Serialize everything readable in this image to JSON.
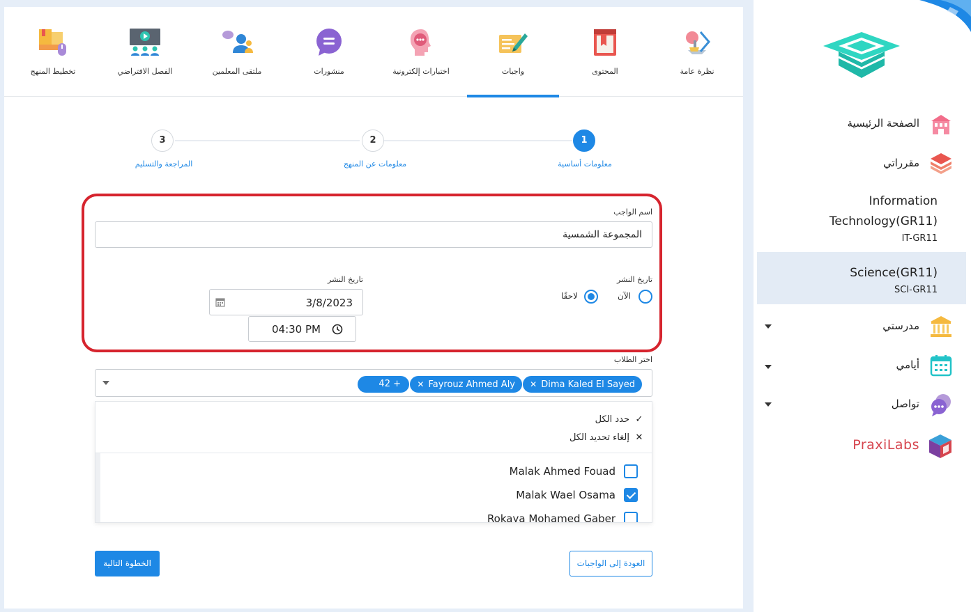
{
  "tabs": [
    {
      "label": "نظرة عامة",
      "icon": "overview-icon"
    },
    {
      "label": "المحتوى",
      "icon": "content-book-icon"
    },
    {
      "label": "واجبات",
      "icon": "assignments-icon",
      "active": true
    },
    {
      "label": "اختبارات إلكترونية",
      "icon": "e-tests-icon"
    },
    {
      "label": "منشورات",
      "icon": "posts-icon"
    },
    {
      "label": "ملتقى المعلمين",
      "icon": "teachers-forum-icon"
    },
    {
      "label": "الفصل الافتراضي",
      "icon": "virtual-class-icon"
    },
    {
      "label": "تخطيط المنهج",
      "icon": "curriculum-planning-icon"
    }
  ],
  "stepper": [
    {
      "number": "1",
      "label": "معلومات أساسية",
      "state": "done"
    },
    {
      "number": "2",
      "label": "معلومات عن المنهج",
      "state": "todo"
    },
    {
      "number": "3",
      "label": "المراجعة والتسليم",
      "state": "todo"
    }
  ],
  "form": {
    "name_label": "اسم الواجب",
    "name_value": "المجموعة الشمسية",
    "publish_label": "تاريخ النشر",
    "publish_now": "الآن",
    "publish_later": "لاحقًا",
    "date_label": "تاريخ النشر",
    "date_value": "3/8/2023",
    "time_value": "04:30 PM",
    "students_label": "اختر الطلاب"
  },
  "chips": [
    {
      "label": "Dima Kaled El Sayed"
    },
    {
      "label": "Fayrouz Ahmed Aly"
    },
    {
      "label": "42 +"
    }
  ],
  "dropdown": {
    "select_all": "حدد الكل",
    "deselect_all": "إلغاء تحديد الكل",
    "options": [
      {
        "name": "Malak Ahmed Fouad",
        "checked": false
      },
      {
        "name": "Malak Wael Osama",
        "checked": true
      },
      {
        "name": "Rokaya Mohamed Gaber",
        "checked": false
      }
    ]
  },
  "buttons": {
    "next": "الخطوة التالية",
    "back": "العودة إلى الواجبات"
  },
  "sidebar": {
    "home": "الصفحة الرئيسية",
    "courses": "مقرراتي",
    "course_list": [
      {
        "title_line1": "Information",
        "title_line2": "Technology(GR11)",
        "code": "IT-GR11"
      },
      {
        "title_line1": "Science(GR11)",
        "code": "SCI-GR11",
        "active": true
      }
    ],
    "school": "مدرستي",
    "days": "أيامي",
    "communication": "تواصل",
    "praxilabs": "PraxiLabs"
  },
  "colors": {
    "accent": "#1e88e5",
    "highlight_border": "#d6242e",
    "sidebar_active": "#e3ebf5"
  }
}
